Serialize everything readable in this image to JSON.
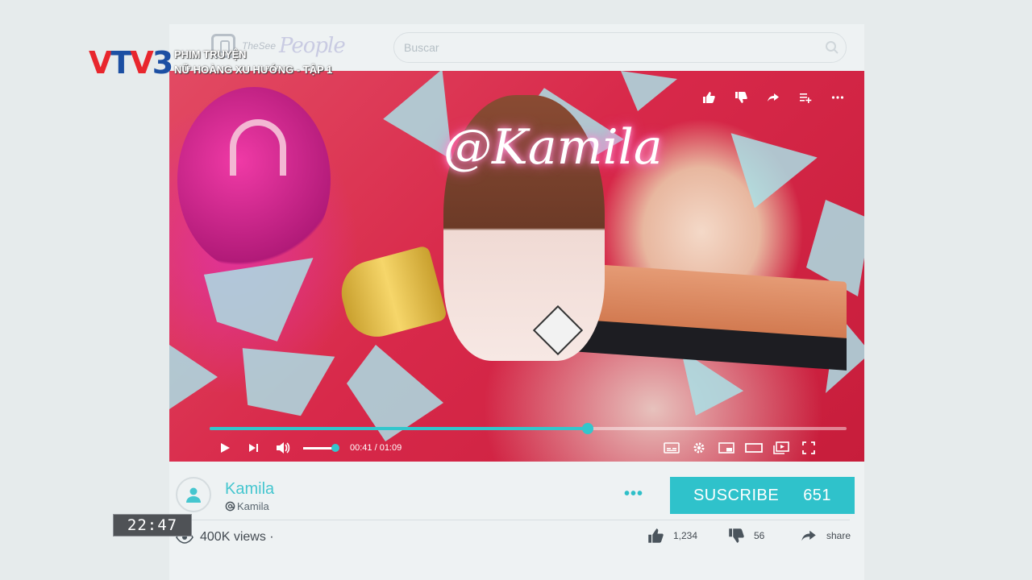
{
  "header": {
    "brand_small": "TheSee",
    "brand_name": "People",
    "search_placeholder": "Buscar"
  },
  "broadcaster": {
    "logo_v": "V",
    "logo_t": "T",
    "logo_v2": "V",
    "logo_num": "3",
    "show_category": "PHIM TRUYỆN",
    "show_title": "NỮ HOÀNG XU HƯỚNG - TẬP 1"
  },
  "video": {
    "neon_text": "@Kamila",
    "current_time": "00:41",
    "duration": "01:09",
    "time_display": "00:41 / 01:09",
    "progress": 0.594,
    "volume": 1.0,
    "top_icons": [
      "like-icon",
      "dislike-icon",
      "share-icon",
      "add-to-playlist-icon",
      "more-icon"
    ],
    "bottom_icons": [
      "play-icon",
      "next-icon",
      "volume-icon",
      "captions-icon",
      "settings-icon",
      "miniplayer-icon",
      "theater-icon",
      "cast-icon",
      "fullscreen-icon"
    ]
  },
  "channel": {
    "name": "Kamila",
    "handle": "Kamila",
    "more_label": "•••",
    "subscribe_label": "SUSCRIBE",
    "subscriber_count": "651"
  },
  "stats": {
    "views": "400K views ·",
    "likes": "1,234",
    "dislikes": "56",
    "share_label": "share"
  },
  "clock": {
    "time": "22:47"
  },
  "colors": {
    "accent": "#2fc2cb",
    "background": "#e6ebec",
    "vtv_red": "#e8262d",
    "vtv_blue": "#1c4fa3"
  }
}
